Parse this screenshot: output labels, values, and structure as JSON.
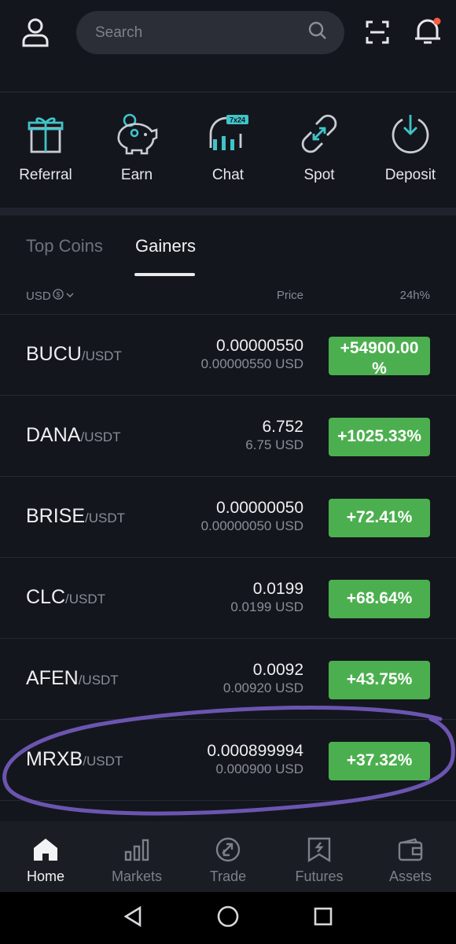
{
  "colors": {
    "accent_teal": "#3fc4c8",
    "gain_green": "#4caf4f",
    "background": "#14161d",
    "annotation_purple": "#6b55b0",
    "notification_dot": "#ff5a3c"
  },
  "header": {
    "search_placeholder": "Search",
    "icons": [
      "user-icon",
      "search-icon",
      "scan-icon",
      "bell-icon"
    ]
  },
  "shortcuts": [
    {
      "label": "Referral",
      "icon": "gift-icon"
    },
    {
      "label": "Earn",
      "icon": "piggy-bank-icon"
    },
    {
      "label": "Chat",
      "icon": "headset-icon",
      "badge": "7x24"
    },
    {
      "label": "Spot",
      "icon": "link-arrows-icon"
    },
    {
      "label": "Deposit",
      "icon": "download-circle-icon"
    }
  ],
  "tabs": [
    {
      "label": "Top Coins",
      "active": false
    },
    {
      "label": "Gainers",
      "active": true
    }
  ],
  "table": {
    "currency_label": "USD",
    "price_header": "Price",
    "change_header": "24h%",
    "rows": [
      {
        "base": "BUCU",
        "quote": "/USDT",
        "price": "0.00000550",
        "price_usd": "0.00000550 USD",
        "change": "+54900.00\n%"
      },
      {
        "base": "DANA",
        "quote": "/USDT",
        "price": "6.752",
        "price_usd": "6.75 USD",
        "change": "+1025.33%"
      },
      {
        "base": "BRISE",
        "quote": "/USDT",
        "price": "0.00000050",
        "price_usd": "0.00000050 USD",
        "change": "+72.41%"
      },
      {
        "base": "CLC",
        "quote": "/USDT",
        "price": "0.0199",
        "price_usd": "0.0199 USD",
        "change": "+68.64%"
      },
      {
        "base": "AFEN",
        "quote": "/USDT",
        "price": "0.0092",
        "price_usd": "0.00920 USD",
        "change": "+43.75%"
      },
      {
        "base": "MRXB",
        "quote": "/USDT",
        "price": "0.000899994",
        "price_usd": "0.000900 USD",
        "change": "+37.32%"
      }
    ]
  },
  "bottom_nav": [
    {
      "label": "Home",
      "icon": "home-icon",
      "active": true
    },
    {
      "label": "Markets",
      "icon": "bar-chart-icon",
      "active": false
    },
    {
      "label": "Trade",
      "icon": "trade-icon",
      "active": false
    },
    {
      "label": "Futures",
      "icon": "futures-icon",
      "active": false
    },
    {
      "label": "Assets",
      "icon": "wallet-icon",
      "active": false
    }
  ]
}
